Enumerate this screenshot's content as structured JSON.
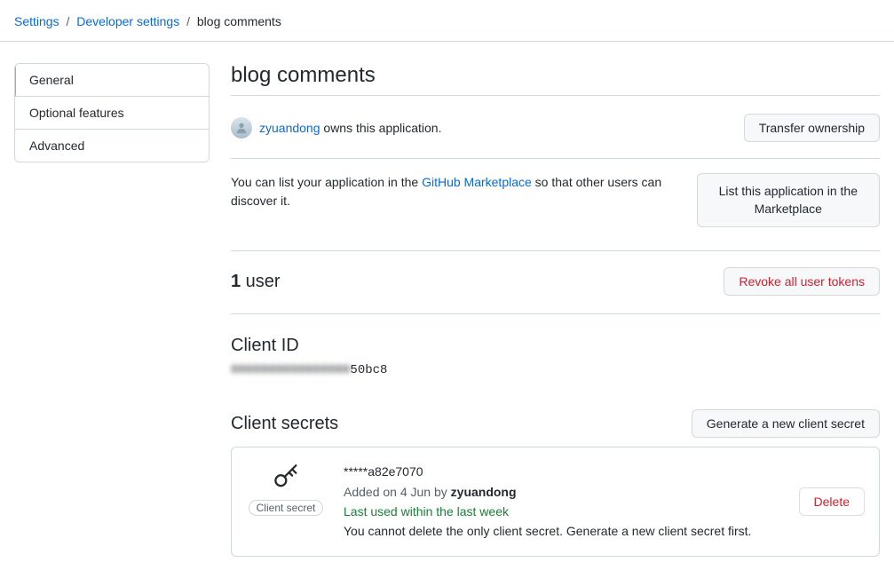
{
  "breadcrumb": {
    "settings": "Settings",
    "developer": "Developer settings",
    "current": "blog comments"
  },
  "sidebar": {
    "items": [
      {
        "label": "General"
      },
      {
        "label": "Optional features"
      },
      {
        "label": "Advanced"
      }
    ]
  },
  "app": {
    "title": "blog comments"
  },
  "owner": {
    "name": "zyuandong",
    "suffix": " owns this application.",
    "transfer_btn": "Transfer ownership"
  },
  "marketplace": {
    "prefix": "You can list your application in the ",
    "link": "GitHub Marketplace",
    "suffix": " so that other users can discover it.",
    "button_line1": "List this application in the",
    "button_line2": "Marketplace"
  },
  "users": {
    "count": "1",
    "label": " user",
    "revoke_btn": "Revoke all user tokens"
  },
  "client_id": {
    "heading": "Client ID",
    "redacted": "0000000000000000",
    "visible": "50bc8"
  },
  "client_secrets": {
    "heading": "Client secrets",
    "generate_btn": "Generate a new client secret",
    "badge": "Client secret",
    "masked": "*****a82e7070",
    "added_prefix": "Added on 4 Jun by ",
    "added_user": "zyuandong",
    "last_used": "Last used within the last week",
    "note": "You cannot delete the only client secret. Generate a new client secret first.",
    "delete_btn": "Delete"
  }
}
